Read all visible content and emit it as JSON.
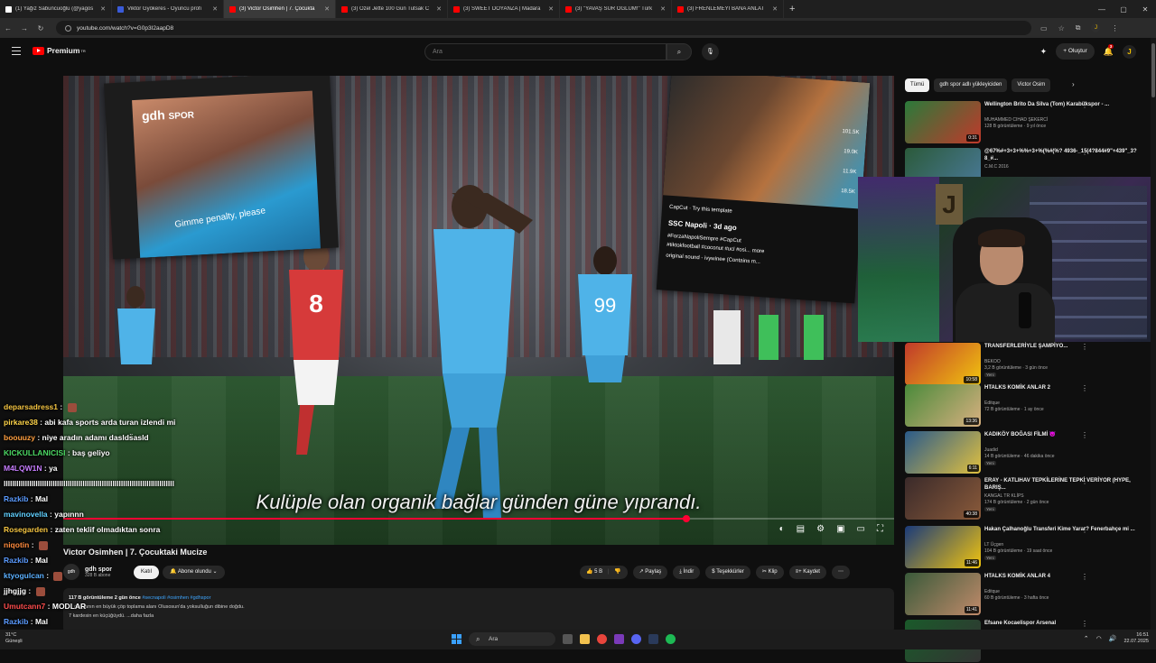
{
  "browser": {
    "tabs": [
      {
        "title": "(1) Yağız Sabuncuoğlu (@yagos",
        "color": "#ffffff",
        "active": false
      },
      {
        "title": "Viktor Gyökeres - Oyuncu profi",
        "color": "#3a5bd9",
        "active": false
      },
      {
        "title": "(3) Victor Osimhen | 7. Çocukta",
        "color": "#ff0000",
        "active": true
      },
      {
        "title": "(3) Özel Jette 100 Gün Tutsak C",
        "color": "#ff0000",
        "active": false
      },
      {
        "title": "(3) SWEET DOYANZA | Madara",
        "color": "#ff0000",
        "active": false
      },
      {
        "title": "(3) \"YAVAŞ SÜR OĞLUM!\" Türk",
        "color": "#ff0000",
        "active": false
      },
      {
        "title": "(3) FRENLEMEYİ BANA ANLAT",
        "color": "#ff0000",
        "active": false
      }
    ],
    "new_tab": "+",
    "url": "youtube.com/watch?v=G0p3I2aapD8"
  },
  "yt_header": {
    "logo_text": "Premium",
    "logo_sup": "TR",
    "search_placeholder": "Ara",
    "create_label": "+ Oluştur",
    "notif_count": "3",
    "avatar_letter": "J"
  },
  "video": {
    "subtitle": "Kulüple olan organik bağlar günden güne yıprandı.",
    "watermark_main": "gdh",
    "watermark_sub": "SPOR",
    "left_inset_caption": "Gimme penalty, please",
    "right_inset": {
      "capcut": "CapCut · Try this template",
      "account": "SSC Napoli · 3d ago",
      "tags": "#ForzaNapoliSempre #CapCut",
      "tags2": "#tiktokfootball #coconut #ucl #osi... more",
      "sound": "original sound - ivywinee (Contains m...",
      "likes": "101.5K",
      "comments": "19.0K",
      "saves": "11.9K",
      "shares": "18.5K"
    },
    "progress_fraction": 0.75,
    "title": "Victor Osimhen | 7. Çocuktaki Mucize",
    "channel": {
      "name": "gdh spor",
      "subs": "328 B abone",
      "avatar_text": "gdh"
    },
    "join_label": "Katıl",
    "subscribe_label": "Abone olundu",
    "actions": {
      "like": "5 B",
      "share": "Paylaş",
      "download": "İndir",
      "thanks": "Teşekkürler",
      "clip": "Klip",
      "save": "Kaydet"
    },
    "description": {
      "stats": "117 B görüntüleme  2 gün önce",
      "tags": "#secnapoli #osimhen #gdhspor",
      "line1": "... dünyanın en büyük çöp toplama alanı Olusosun'da yoksulluğun dibine doğdu.",
      "line2": "7 kardesin en küçüğüydü. ...daha fazla"
    }
  },
  "chat": [
    {
      "user": "deparsadress1",
      "msg": "",
      "color": "#f5c542",
      "emote": true
    },
    {
      "user": "pirkare38",
      "msg": "abi kafa sports arda turan izlendi mi",
      "color": "#ffd54a",
      "emote": false
    },
    {
      "user": "boouuzy",
      "msg": "niye aradın adamı daslds̈asld",
      "color": "#ff9f40",
      "emote": false
    },
    {
      "user": "KICKULLANICISI",
      "msg": "baş geliyo",
      "color": "#4cd964",
      "emote": false
    },
    {
      "user": "M4LQW1N",
      "msg": "ya",
      "color": "#c77dff",
      "emote": false
    },
    {
      "user": "",
      "msg": "llllllllllllllllllllllllllllllllllllllllllllllllllllllllllllllllllllllllllllllll",
      "color": "#ffffff",
      "emote": false
    },
    {
      "user": "Razkib",
      "msg": "Mal",
      "color": "#5b9bff",
      "emote": false
    },
    {
      "user": "mavinovella",
      "msg": "yapınnn",
      "color": "#60d0ff",
      "emote": false
    },
    {
      "user": "Rosegarden",
      "msg": "zaten teklif olmadıktan sonra",
      "color": "#f5c542",
      "emote": false
    },
    {
      "user": "niqotin",
      "msg": "",
      "color": "#ff8a3d",
      "emote": true
    },
    {
      "user": "Razkib",
      "msg": "Mal",
      "color": "#5b9bff",
      "emote": false
    },
    {
      "user": "ktyogulcan",
      "msg": "",
      "color": "#5bb0ff",
      "emote": true
    },
    {
      "user": "jjhgjjg",
      "msg": "",
      "color": "#ffffff",
      "emote": true
    },
    {
      "user": "Umutcann7",
      "msg": "MODLAR",
      "color": "#ff4d4d",
      "emote": false
    },
    {
      "user": "Razkib",
      "msg": "Mal",
      "color": "#5b9bff",
      "emote": false
    }
  ],
  "sidebar": {
    "chips": [
      "Tümü",
      "gdh spor adlı yükleyiciden",
      "Victor Osim"
    ],
    "recs": [
      {
        "title": "Wellington Brito Da Silva (Tom) Karabükspor - ...",
        "channel": "MUHAMMED CIHAD ŞEKERCİ",
        "views": "128 B görüntüleme · 9 yıl önce",
        "duration": "0:31",
        "badge": "",
        "c1": "#2a7a3a",
        "c2": "#c0392b"
      },
      {
        "title": "@67%#+3+3+%%+3+%(%#(%? 4936-_15(4?844#9\"+439\"_3?8_#...",
        "channel": "C.M.C 2016",
        "views": "",
        "duration": "",
        "badge": "",
        "c1": "#2b5a3a",
        "c2": "#4a7a9a"
      },
      {
        "title": "TRANSFERLERİYLE ŞAMPİYO...",
        "channel": "BEKOO",
        "views": "3,2 B görüntüleme · 3 gün önce",
        "duration": "10:58",
        "badge": "Yeni",
        "c1": "#c0392b",
        "c2": "#f1c40f"
      },
      {
        "title": "HTALKS KOMİK ANLAR 2",
        "channel": "Editque",
        "views": "72 B görüntüleme · 1 ay önce",
        "duration": "13:36",
        "badge": "",
        "c1": "#4a8a3a",
        "c2": "#d8b080"
      },
      {
        "title": "KADIKÖY BOĞASI FİLMİ 😈",
        "channel": "Juadid",
        "views": "14 B görüntüleme · 46 dakika önce",
        "duration": "6:11",
        "badge": "Yeni",
        "c1": "#2a5a8a",
        "c2": "#e0c040"
      },
      {
        "title": "ERAY - KATLIHAV TEPKİLERİNE TEPKİ VERİYOR (HYPE, BARIŞ...",
        "channel": "KANGAL TR KLİPS",
        "views": "174 B görüntüleme · 2 gün önce",
        "duration": "40:38",
        "badge": "Yeni",
        "c1": "#3a2a2a",
        "c2": "#8a5a3a"
      },
      {
        "title": "Hakan Çalhanoğlu Transferi Kime Yarar? Fenerbahçe mi ...",
        "channel": "LT Üçgen",
        "views": "104 B görüntüleme · 19 saat önce",
        "duration": "11:46",
        "badge": "Yeni",
        "c1": "#1a3a7a",
        "c2": "#f1c40f"
      },
      {
        "title": "HTALKS KOMİK ANLAR 4",
        "channel": "Editque",
        "views": "60 B görüntüleme · 3 hafta önce",
        "duration": "11:41",
        "badge": "",
        "c1": "#3a5a3a",
        "c2": "#c08a6a"
      },
      {
        "title": "Efsane Kocaelispor Arsenal",
        "channel": "",
        "views": "",
        "duration": "",
        "badge": "",
        "c1": "#1a5a2a",
        "c2": "#333333"
      }
    ]
  },
  "taskbar": {
    "temp": "31°C",
    "weather": "Güneşli",
    "search": "Ara",
    "time": "16:51",
    "date": "22.07.2025"
  }
}
